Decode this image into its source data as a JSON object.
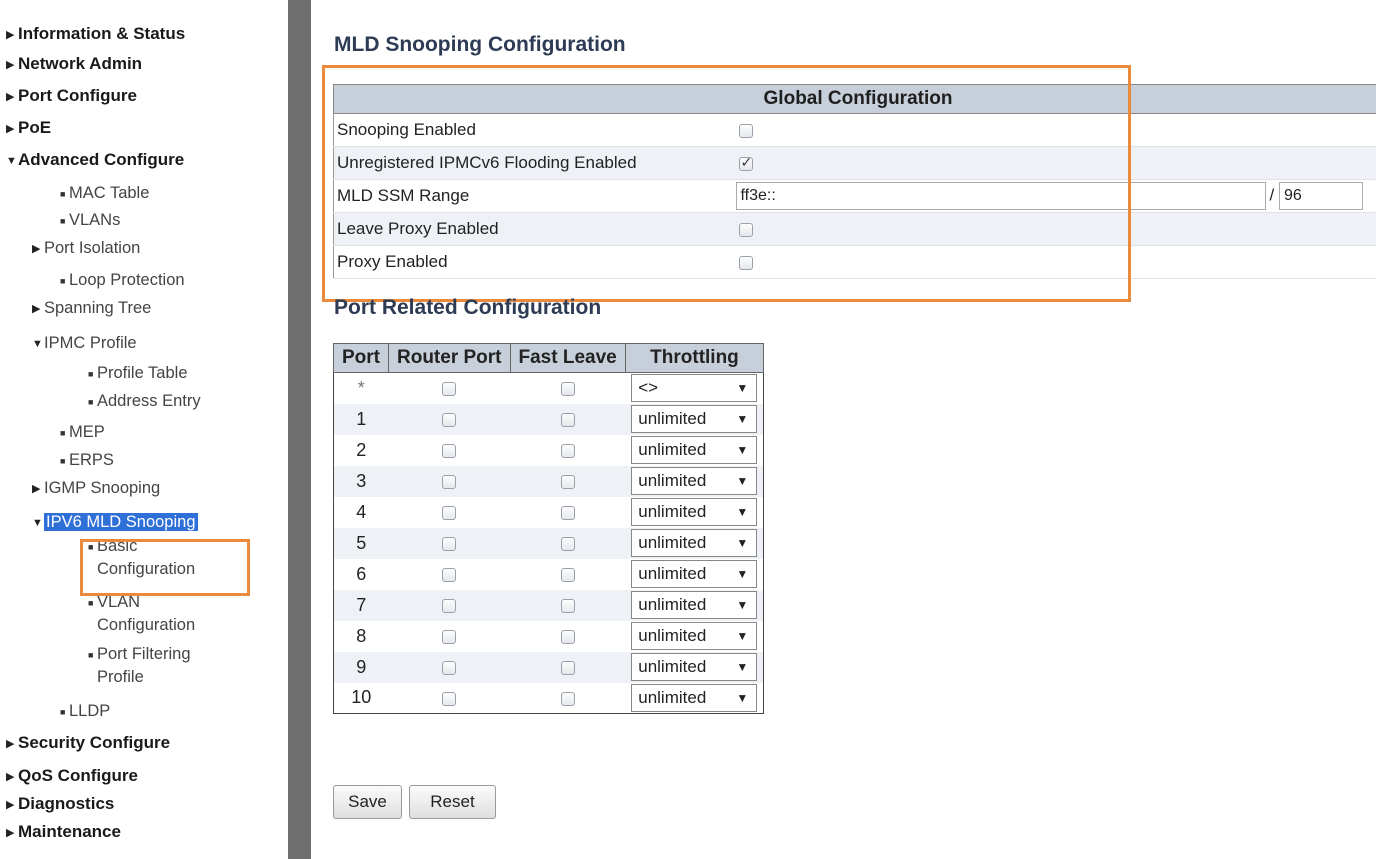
{
  "sidebar": {
    "items": [
      {
        "label": "Information & Status",
        "level": 0,
        "marker": "▶"
      },
      {
        "label": "Network Admin",
        "level": 0,
        "marker": "▶"
      },
      {
        "label": "Port Configure",
        "level": 0,
        "marker": "▶"
      },
      {
        "label": "PoE",
        "level": 0,
        "marker": "▶"
      },
      {
        "label": "Advanced Configure",
        "level": 0,
        "marker": "▼"
      },
      {
        "label": "MAC Table",
        "level": 1,
        "marker": "■"
      },
      {
        "label": "VLANs",
        "level": 1,
        "marker": "■"
      },
      {
        "label": "Port Isolation",
        "level": 1,
        "marker": "▶"
      },
      {
        "label": "Loop Protection",
        "level": 1,
        "marker": "■"
      },
      {
        "label": "Spanning Tree",
        "level": 1,
        "marker": "▶"
      },
      {
        "label": "IPMC Profile",
        "level": 1,
        "marker": "▼"
      },
      {
        "label": "Profile Table",
        "level": 2,
        "marker": "■"
      },
      {
        "label": "Address Entry",
        "level": 2,
        "marker": "■"
      },
      {
        "label": "MEP",
        "level": 1,
        "marker": "■"
      },
      {
        "label": "ERPS",
        "level": 1,
        "marker": "■"
      },
      {
        "label": "IGMP Snooping",
        "level": 1,
        "marker": "▶"
      },
      {
        "label": "IPV6 MLD Snooping",
        "level": 1,
        "marker": "▼"
      },
      {
        "label": "Basic",
        "label2": "Configuration",
        "level": 2,
        "marker": "■"
      },
      {
        "label": "VLAN",
        "label2": "Configuration",
        "level": 2,
        "marker": "■"
      },
      {
        "label": "Port Filtering",
        "label2": "Profile",
        "level": 2,
        "marker": "■"
      },
      {
        "label": "LLDP",
        "level": 1,
        "marker": "■"
      },
      {
        "label": "Security Configure",
        "level": 0,
        "marker": "▶"
      },
      {
        "label": "QoS Configure",
        "level": 0,
        "marker": "▶"
      },
      {
        "label": "Diagnostics",
        "level": 0,
        "marker": "▶"
      },
      {
        "label": "Maintenance",
        "level": 0,
        "marker": "▶"
      }
    ],
    "selected_index": 16
  },
  "page_title": "MLD Snooping Configuration",
  "global": {
    "header": "Global Configuration",
    "rows": [
      {
        "label": "Snooping Enabled",
        "checked": false
      },
      {
        "label": "Unregistered IPMCv6 Flooding Enabled",
        "checked": true
      },
      {
        "label": "MLD SSM Range",
        "address": "ff3e::",
        "separator": "/",
        "prefix": "96"
      },
      {
        "label": "Leave Proxy Enabled",
        "checked": false
      },
      {
        "label": "Proxy Enabled",
        "checked": false
      }
    ]
  },
  "port_section_title": "Port Related Configuration",
  "port_table": {
    "headers": [
      "Port",
      "Router Port",
      "Fast Leave",
      "Throttling"
    ],
    "rows": [
      {
        "port": "*",
        "throttling": "<>"
      },
      {
        "port": "1",
        "throttling": "unlimited"
      },
      {
        "port": "2",
        "throttling": "unlimited"
      },
      {
        "port": "3",
        "throttling": "unlimited"
      },
      {
        "port": "4",
        "throttling": "unlimited"
      },
      {
        "port": "5",
        "throttling": "unlimited"
      },
      {
        "port": "6",
        "throttling": "unlimited"
      },
      {
        "port": "7",
        "throttling": "unlimited"
      },
      {
        "port": "8",
        "throttling": "unlimited"
      },
      {
        "port": "9",
        "throttling": "unlimited"
      },
      {
        "port": "10",
        "throttling": "unlimited"
      }
    ]
  },
  "buttons": {
    "save": "Save",
    "reset": "Reset"
  },
  "colors": {
    "highlight": "#ea8a3d",
    "header_bg": "#c7cfdb",
    "selected_bg": "#2f6fd8",
    "divider": "#6e6e6e"
  }
}
